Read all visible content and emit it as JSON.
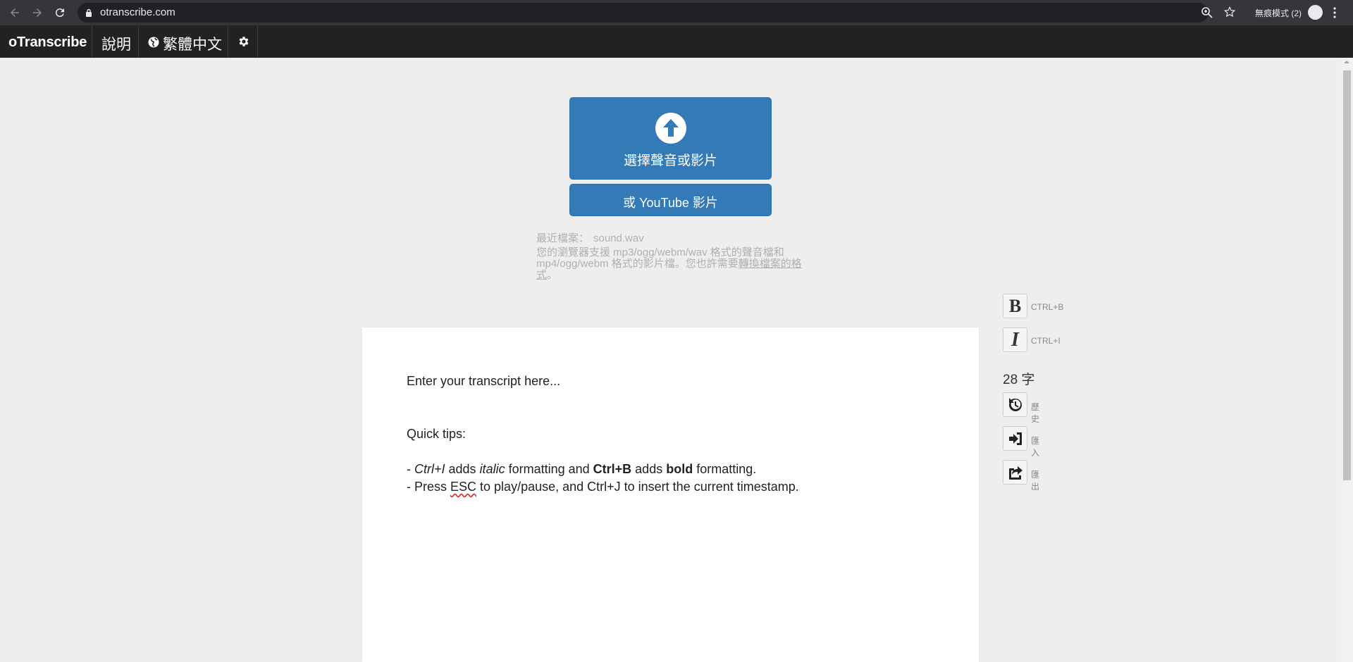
{
  "browser": {
    "url": "otranscribe.com",
    "incognito_label": "無痕模式 (2)"
  },
  "appbar": {
    "brand": "oTranscribe",
    "help": "說明",
    "language": "繁體中文"
  },
  "upload": {
    "choose_label": "選擇聲音或影片",
    "youtube_label": "或 YouTube 影片"
  },
  "file_info": {
    "recent_label": "最近檔案：",
    "recent_file": "sound.wav",
    "support_text": "您的瀏覽器支援 mp3/ogg/webm/wav 格式的聲音檔和 mp4/ogg/webm 格式的影片檔。您也許需要",
    "convert_link": "轉換檔案的格式",
    "support_end": "。"
  },
  "editor": {
    "line1": "Enter your transcript here...",
    "tips_title": "Quick tips:",
    "tip1_prefix": "- ",
    "tip1_ctrl_i": "Ctrl+I",
    "tip1_adds1": " adds ",
    "tip1_italic": "italic",
    "tip1_mid": " formatting and ",
    "tip1_ctrl_b": "Ctrl+B",
    "tip1_adds2": " adds ",
    "tip1_bold": "bold",
    "tip1_end": " formatting.",
    "tip2_prefix": "- Press ",
    "tip2_esc": "ESC",
    "tip2_rest": " to play/pause, and Ctrl+J to insert the current timestamp."
  },
  "toolbar": {
    "bold_glyph": "B",
    "bold_shortcut": "CTRL+B",
    "italic_glyph": "I",
    "italic_shortcut": "CTRL+I",
    "word_count": "28 字",
    "history": "歷史",
    "import": "匯入",
    "export": "匯出"
  },
  "colors": {
    "primary": "#337ab7",
    "navbar": "#222222",
    "background": "#eeeeee"
  }
}
